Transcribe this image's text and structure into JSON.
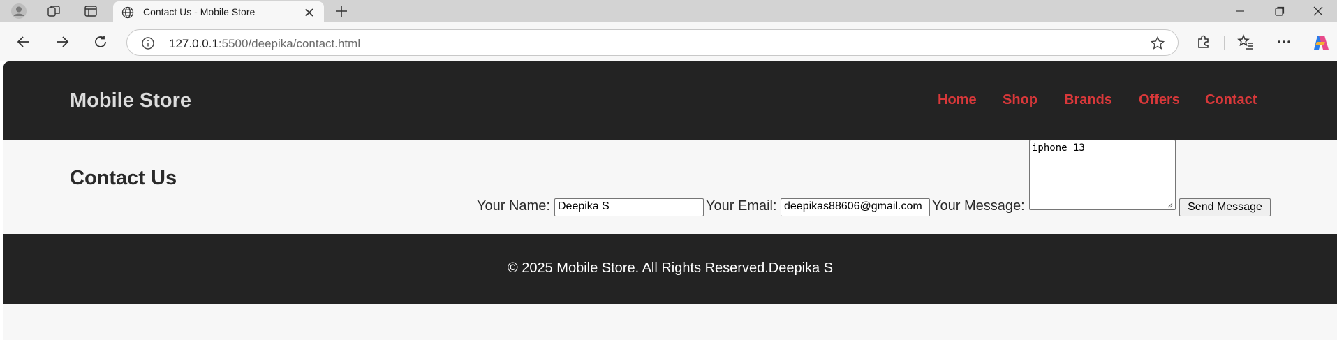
{
  "browser": {
    "tab_title": "Contact Us - Mobile Store",
    "url_host": "127.0.0.1",
    "url_rest": ":5500/deepika/contact.html"
  },
  "site": {
    "logo": "Mobile Store",
    "nav": [
      "Home",
      "Shop",
      "Brands",
      "Offers",
      "Contact"
    ],
    "accent_color": "#d9383a",
    "header_color": "#232323"
  },
  "contact": {
    "title": "Contact Us",
    "name_label": "Your Name:",
    "name_value": "Deepika S",
    "email_label": "Your Email:",
    "email_value": "deepikas88606@gmail.com",
    "message_label": "Your Message:",
    "message_value": "iphone 13",
    "send_label": "Send Message"
  },
  "footer": {
    "text": "© 2025 Mobile Store. All Rights Reserved.Deepika S"
  }
}
